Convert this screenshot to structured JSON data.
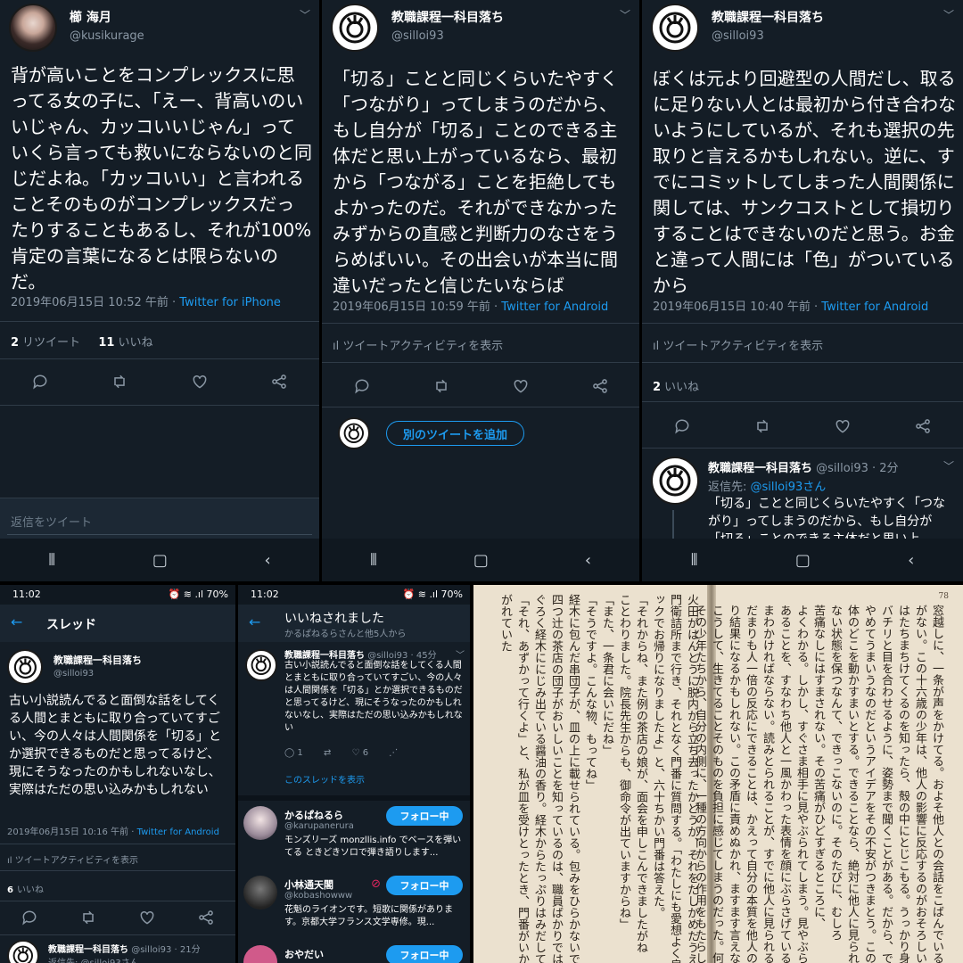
{
  "panel1": {
    "name": "櫛 海月",
    "handle": "@kusikurage",
    "body": "背が高いことをコンプレックスに思ってる女の子に、「えー、背高いのいいじゃん、カッコいいじゃん」っていくら言っても救いにならないのと同じだよね。「カッコいい」と言われることそのものがコンプレックスだったりすることもあるし、それが100%肯定の言葉になるとは限らないのだ。",
    "timestamp": "2019年06月15日 10:52 午前 · ",
    "source": "Twitter for iPhone",
    "retweets": "2",
    "retweets_label": "リツイート",
    "likes": "11",
    "likes_label": "いいね",
    "reply_placeholder": "返信をツイート"
  },
  "panel2": {
    "name": "教職課程一科目落ち",
    "handle": "@silloi93",
    "body": "「切る」ことと同じくらいたやすく「つながり」ってしまうのだから、もし自分が「切る」ことのできる主体だと思い上がっているなら、最初から「つながる」ことを拒絶してもよかったのだ。それができなかったみずからの直感と判断力のなさをうらめばいい。その出会いが本当に間違いだったと信じたいならば",
    "timestamp": "2019年06月15日 10:59 午前 · ",
    "source": "Twitter for Android",
    "activity": "ツイートアクティビティを表示",
    "add_button": "別のツイートを追加"
  },
  "panel3": {
    "name": "教職課程一科目落ち",
    "handle": "@silloi93",
    "body": "ぼくは元より回避型の人間だし、取るに足りない人とは最初から付き合わないようにしているが、それも選択の先取りと言えるかもしれない。逆に、すでにコミットしてしまった人間関係に関しては、サンクコストとして損切りすることはできないのだと思う。お金と違って人間には「色」がついているから",
    "timestamp": "2019年06月15日 10:40 午前 · ",
    "source": "Twitter for Android",
    "activity": "ツイートアクティビティを表示",
    "likes": "2",
    "likes_label": "いいね",
    "reply_name": "教職課程一科目落ち",
    "reply_handle": "@silloi93 · 2分",
    "reply_to_label": "返信先: ",
    "reply_to": "@silloi93さん",
    "reply_body": "「切る」ことと同じくらいたやすく「つながり」ってしまうのだから、もし自分が「切る」ことのできる主体だと思い上"
  },
  "panel4": {
    "time": "11:02",
    "battery": "70%",
    "title": "スレッド",
    "name": "教職課程一科目落ち",
    "handle": "@silloi93",
    "body": "古い小説読んでると面倒な話をしてくる人間とまともに取り合っていてすごい、今の人々は人間関係を「切る」とか選択できるものだと思ってるけど、現にそうなったのかもしれないなし、実際はただの思い込みかもしれない",
    "timestamp": "2019年06月15日 10:16 午前 · ",
    "source": "Twitter for Android",
    "activity": "ツイートアクティビティを表示",
    "likes": "6",
    "likes_label": "いいね",
    "next_name": "教職課程一科目落ち",
    "next_handle": "@silloi93 · 21分",
    "next_reply": "返信先: @silloi93さん"
  },
  "panel5": {
    "time": "11:02",
    "battery": "70%",
    "title": "いいねされました",
    "subtitle": "かるぱねるらさんと他5人から",
    "name": "教職課程一科目落ち",
    "handle": "@silloi93 · 45分",
    "body": "古い小説読んでると面倒な話をしてくる人間とまともに取り合っていてすごい、今の人々は人間関係を「切る」とか選択できるものだと思ってるけど、現にそうなったのかもしれないなし、実際はただの思い込みかもしれない",
    "replies": "1",
    "likes": "6",
    "thread_link": "このスレッドを表示",
    "follow_label": "フォロー中",
    "users": [
      {
        "name": "かるぱねるら",
        "handle": "@karupanerura",
        "bio": "モンズリーズ monzllis.info でベースを弾いてる ときどきソロで弾き語りします..."
      },
      {
        "name": "小林通天閣",
        "handle": "@kobashowww",
        "bio": "花魁のライオンです。短歌に関係があります。京都大学フランス文学専修。現..."
      },
      {
        "name": "おやだい",
        "handle": "",
        "bio": ""
      }
    ]
  },
  "book": {
    "page_number": "78",
    "right_lines": [
      "窓越しに、一条が声をかけてる。およそ他人との会話をこばんでいる網代",
      "がない。この十六歳の少年は、他人の影響に反応するのがおそろしい。何者かが",
      "はたちまちけてくるのを知ったら、殻の中にとじこもる。うっかり身を動かせ",
      "バチリと目を合わせるように、姿勢まで聞くことがある。だから、できるだけ他人",
      "やめてうまいうなのだというアイデアをその不安がつきまとう。このさわがしい集団の中で、彼のように",
      "体のどこを動かすまいとする。できることなら、絶対に他人に見られたくない。",
      "ない状態を保つなんて、できっこないのに。そのたびに、むしろ",
      "苦痛なしにはすまされない。その苦痛がひどすぎるところに、",
      "よくわかる。しかし、すぐさま相手に見やぶられてしまう。見やぶられないように",
      "あることを、すなわち他人と一風かわった表情を顔にぶらさげていること",
      "まわかければならない。読みとられることが、すでに他人に見られるために",
      "だまりも人一倍の反応にできることは、かえって自分の本質を他人の眼の前に",
      "り結果になるかもしれない。この矛盾に責めぬかれ、ますます言えなくなる。",
      "こうして、生きてることそのものを負担に感じてしまうのだった。何らかの作用が",
      "その少年たちから、自分の内側に、一種の方向からの作用をもたらしている。"
    ],
    "left_lines": [
      "火田がはんとうに脱内から立ち去ったかどうか、それをたしかめたうえで",
      "門衛詰所まで行き、それとなく門番に質問する。「わたしにも愛想よく肩をすぼめて",
      "ックでお帰りになりましたよ」と、六十ちかい門番は答えた。",
      "「それからね、また例の茶店の娘が、面会を申しこんできましたがね",
      "ことわりました。院長先生からも、御命令が出ていますからね」",
      "「また、一条君に会いにだね」",
      "「そうですよ。こんな物、もってね」",
      "経木に包んだ串団子が、皿の上に載せられている。包みをひらかないでも",
      "四つ辻の茶店の団子がおいしいことを知っているのは、職員ばかりではない",
      "ぐろく経木ににじみ出ている醤油の香り。経木からたっぷりはみだしている",
      "「それ、あずかって行くよ」と、私が皿を受けとったとき、門番がいかにも",
      "がれていた"
    ]
  },
  "colors": {
    "background": "#141d26",
    "accent": "#1d9bf0",
    "muted": "#8b98a5"
  }
}
